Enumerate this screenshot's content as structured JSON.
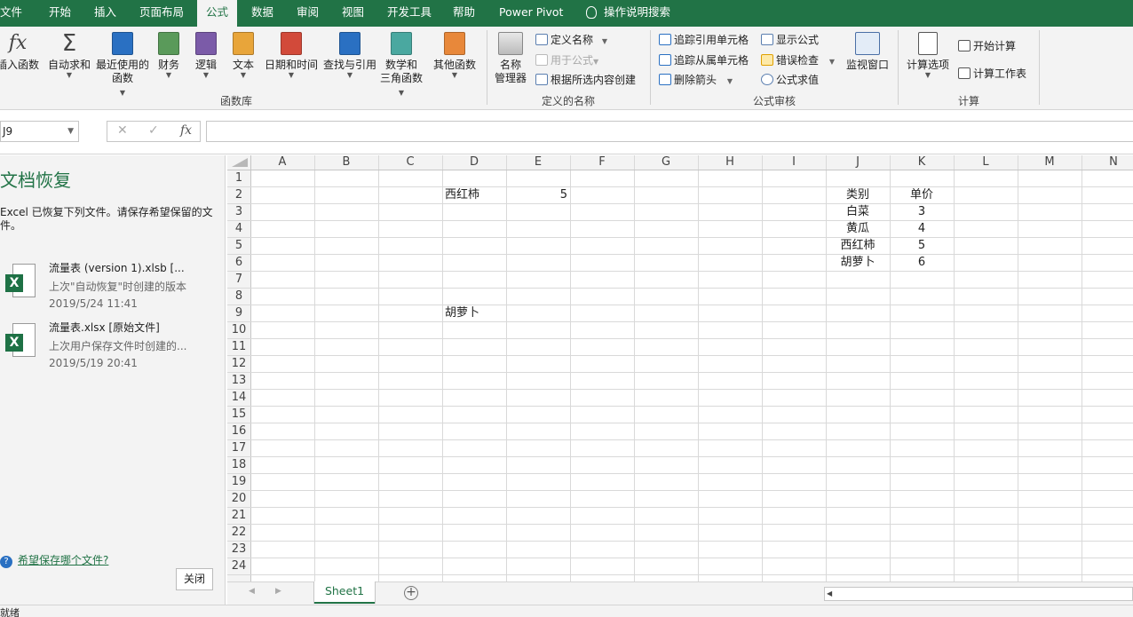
{
  "tabs": [
    {
      "label": "文件",
      "active": false
    },
    {
      "label": "开始",
      "active": false
    },
    {
      "label": "插入",
      "active": false
    },
    {
      "label": "页面布局",
      "active": false
    },
    {
      "label": "公式",
      "active": true
    },
    {
      "label": "数据",
      "active": false
    },
    {
      "label": "审阅",
      "active": false
    },
    {
      "label": "视图",
      "active": false
    },
    {
      "label": "开发工具",
      "active": false
    },
    {
      "label": "帮助",
      "active": false
    },
    {
      "label": "Power Pivot",
      "active": false
    }
  ],
  "tell_me": "操作说明搜索",
  "ribbon": {
    "function_library": {
      "group_label": "函数库",
      "buttons": [
        {
          "label": "插入函数",
          "label2": "",
          "icon": "insert-function-icon"
        },
        {
          "label": "自动求和",
          "label2": "",
          "icon": "autosum-icon"
        },
        {
          "label": "最近使用的",
          "label2": "函数",
          "icon": "recent-functions-icon"
        },
        {
          "label": "财务",
          "label2": "",
          "icon": "financial-icon"
        },
        {
          "label": "逻辑",
          "label2": "",
          "icon": "logical-icon"
        },
        {
          "label": "文本",
          "label2": "",
          "icon": "text-icon"
        },
        {
          "label": "日期和时间",
          "label2": "",
          "icon": "date-time-icon"
        },
        {
          "label": "查找与引用",
          "label2": "",
          "icon": "lookup-reference-icon"
        },
        {
          "label": "数学和",
          "label2": "三角函数",
          "icon": "math-trig-icon"
        },
        {
          "label": "其他函数",
          "label2": "",
          "icon": "more-functions-icon"
        }
      ]
    },
    "defined_names": {
      "group_label": "定义的名称",
      "name_manager": "名称",
      "name_manager2": "管理器",
      "define_name": "定义名称",
      "use_in_formula": "用于公式",
      "create_from_selection": "根据所选内容创建"
    },
    "formula_auditing": {
      "group_label": "公式审核",
      "trace_precedents": "追踪引用单元格",
      "trace_dependents": "追踪从属单元格",
      "remove_arrows": "删除箭头",
      "show_formulas": "显示公式",
      "error_checking": "错误检查",
      "evaluate_formula": "公式求值",
      "watch_window": "监视窗口"
    },
    "calculation": {
      "group_label": "计算",
      "calc_options": "计算选项",
      "calc_now": "开始计算",
      "calc_sheet": "计算工作表"
    }
  },
  "formula_bar": {
    "name_box": "J9",
    "formula": ""
  },
  "recovery": {
    "title": "文档恢复",
    "description": "Excel 已恢复下列文件。请保存希望保留的文件。",
    "files": [
      {
        "name": "流量表 (version 1).xlsb  [...",
        "subtitle": "上次\"自动恢复\"时创建的版本",
        "date": "2019/5/24 11:41"
      },
      {
        "name": "流量表.xlsx  [原始文件]",
        "subtitle": "上次用户保存文件时创建的...",
        "date": "2019/5/19 20:41"
      }
    ],
    "help_link": "希望保存哪个文件?",
    "close_button": "关闭"
  },
  "sheet": {
    "columns": [
      "A",
      "B",
      "C",
      "D",
      "E",
      "F",
      "G",
      "H",
      "I",
      "J",
      "K",
      "L",
      "M",
      "N"
    ],
    "rows": [
      "1",
      "2",
      "3",
      "4",
      "5",
      "6",
      "7",
      "8",
      "9",
      "10",
      "11",
      "12",
      "13",
      "14",
      "15",
      "16",
      "17",
      "18",
      "19",
      "20",
      "21",
      "22",
      "23",
      "24"
    ],
    "cells": [
      {
        "ref": "D2",
        "value": "西红柿",
        "align": "left"
      },
      {
        "ref": "E2",
        "value": "5",
        "align": "right"
      },
      {
        "ref": "D9",
        "value": "胡萝卜",
        "align": "left"
      },
      {
        "ref": "J2",
        "value": "类别",
        "align": "center"
      },
      {
        "ref": "K2",
        "value": "单价",
        "align": "center"
      },
      {
        "ref": "J3",
        "value": "白菜",
        "align": "center"
      },
      {
        "ref": "K3",
        "value": "3",
        "align": "center"
      },
      {
        "ref": "J4",
        "value": "黄瓜",
        "align": "center"
      },
      {
        "ref": "K4",
        "value": "4",
        "align": "center"
      },
      {
        "ref": "J5",
        "value": "西红柿",
        "align": "center"
      },
      {
        "ref": "K5",
        "value": "5",
        "align": "center"
      },
      {
        "ref": "J6",
        "value": "胡萝卜",
        "align": "center"
      },
      {
        "ref": "K6",
        "value": "6",
        "align": "center"
      }
    ]
  },
  "sheet_tab": "Sheet1",
  "status": {
    "ready": "就绪"
  },
  "colors": {
    "accent": "#217346",
    "grid": "#d9d9d9",
    "header_bg": "#f3f3f3"
  }
}
